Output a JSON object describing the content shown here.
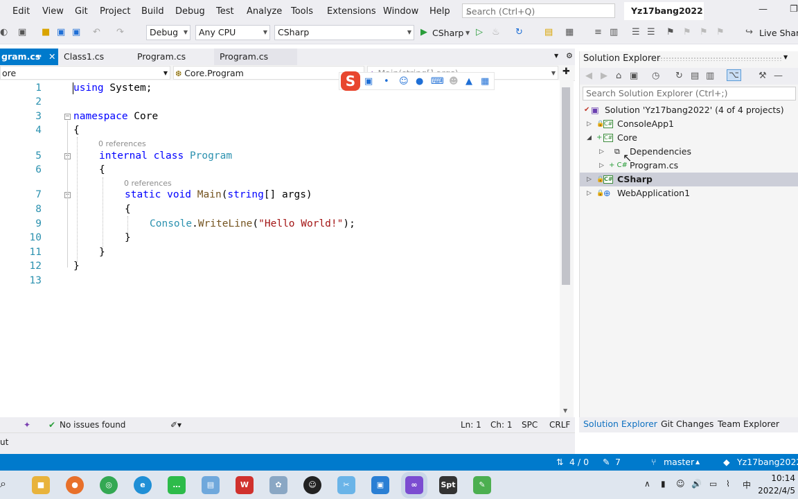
{
  "menu": {
    "items": [
      "Edit",
      "View",
      "Git",
      "Project",
      "Build",
      "Debug",
      "Test",
      "Analyze",
      "Tools",
      "Extensions",
      "Window",
      "Help"
    ],
    "search_placeholder": "Search (Ctrl+Q)",
    "solution_name": "Yz17bang2022"
  },
  "toolbar": {
    "config": "Debug",
    "platform": "Any CPU",
    "startup_project": "CSharp",
    "run_label": "CSharp",
    "live_share": "Live Share"
  },
  "tabs": [
    {
      "label": "gram.cs",
      "active": true
    },
    {
      "label": "Class1.cs",
      "active": false
    },
    {
      "label": "Program.cs",
      "active": false
    },
    {
      "label": "Program.cs",
      "active": false
    }
  ],
  "navbar": {
    "project": "ore",
    "type": "Core.Program",
    "member": "Main(string[] args)"
  },
  "code": {
    "line_numbers": [
      "1",
      "2",
      "3",
      "4",
      "5",
      "6",
      "7",
      "8",
      "9",
      "10",
      "11",
      "12",
      "13"
    ],
    "ref_label": "0 references",
    "l1_kw": "using",
    "l1_rest": " System;",
    "l3_kw": "namespace",
    "l3_rest": " Core",
    "open_brace": "{",
    "close_brace": "}",
    "l5_kw": "internal class",
    "l5_type": "Program",
    "l7_kw": "static void",
    "l7_method": "Main",
    "l7_paren": "(",
    "l7_kw2": "string",
    "l7_rest": "[] args)",
    "l9_type": "Console",
    "l9_dot": ".",
    "l9_method": "WriteLine",
    "l9_open": "(",
    "l9_str": "\"Hello World!\"",
    "l9_close": ");"
  },
  "editor_status": {
    "issues": "No issues found",
    "ln": "Ln: 1",
    "ch": "Ch: 1",
    "spc": "SPC",
    "crlf": "CRLF"
  },
  "output_label": "ut",
  "solution_explorer": {
    "title": "Solution Explorer",
    "search_placeholder": "Search Solution Explorer (Ctrl+;)",
    "solution": "Solution 'Yz17bang2022' (4 of 4 projects)",
    "items": [
      {
        "label": "ConsoleApp1"
      },
      {
        "label": "Core"
      },
      {
        "label": "Dependencies"
      },
      {
        "label": "Program.cs"
      },
      {
        "label": "CSharp"
      },
      {
        "label": "WebApplication1"
      }
    ],
    "bottom_tabs": [
      "Solution Explorer",
      "Git Changes",
      "Team Explorer"
    ]
  },
  "status_bar": {
    "changes": "4 / 0",
    "edits": "7",
    "branch": "master",
    "repo": "Yz17bang2022"
  },
  "taskbar": {
    "time": "10:14",
    "date": "2022/4/5",
    "ime": "中"
  },
  "colors": {
    "accent": "#007acc",
    "keyword": "#0000ff",
    "type": "#2b91af",
    "string": "#a31515"
  }
}
